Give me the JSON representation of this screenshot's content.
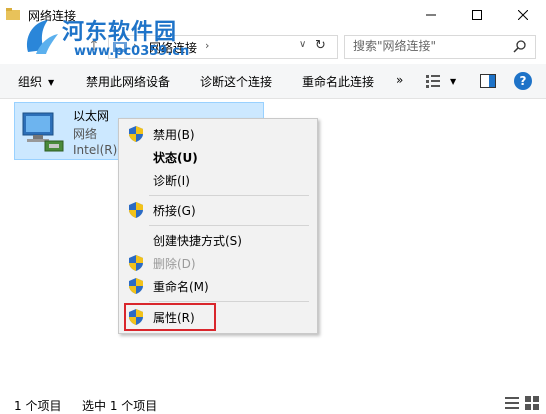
{
  "window": {
    "title": "网络连接"
  },
  "watermark": {
    "text": "河东软件园",
    "url": "www.pc0359.cn"
  },
  "address": {
    "path": "网络连接",
    "search_placeholder": "搜索\"网络连接\""
  },
  "toolbar": {
    "organize": "组织",
    "disable_device": "禁用此网络设备",
    "diagnose": "诊断这个连接",
    "rename": "重命名此连接",
    "more": "»"
  },
  "connection": {
    "name": "以太网",
    "network": "网络",
    "device": "Intel(R) 8"
  },
  "context_menu": {
    "items": [
      {
        "label": "禁用(B)",
        "shield": true
      },
      {
        "label": "状态(U)",
        "bold": true
      },
      {
        "label": "诊断(I)"
      },
      {
        "label": "桥接(G)",
        "shield": true
      },
      {
        "label": "创建快捷方式(S)"
      },
      {
        "label": "删除(D)",
        "shield": true,
        "disabled": true
      },
      {
        "label": "重命名(M)",
        "shield": true
      },
      {
        "label": "属性(R)",
        "shield": true
      }
    ]
  },
  "status": {
    "count": "1 个项目",
    "selected": "选中 1 个项目"
  },
  "colors": {
    "accent": "#1e73c8",
    "selection": "#cce8ff",
    "highlight_border": "#d9262c"
  }
}
